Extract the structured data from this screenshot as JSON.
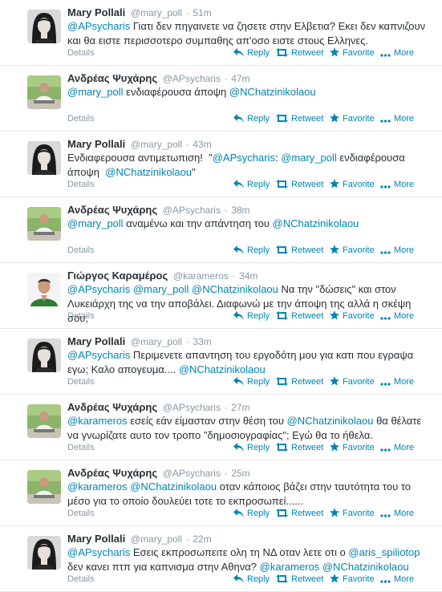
{
  "colors": {
    "link": "#0084b4",
    "meta": "#8899a6",
    "name": "#292f33"
  },
  "actions": {
    "details": "Details",
    "reply": "Reply",
    "retweet": "Retweet",
    "favorite": "Favorite",
    "more": "More"
  },
  "tweets": [
    {
      "fullname": "Mary Pollali",
      "username": "@mary_poll",
      "time": "51m",
      "avatar": "woman",
      "segments": [
        {
          "t": "@APsycharis",
          "m": true
        },
        {
          "t": " Γιατι δεν πηγαινετε να ζησετε στην Ελβετια? Εκει δεν καπνιζουν και θα ειστε περισσοτερο συμπαθης απ'οσο ειστε στους Ελληνες."
        }
      ]
    },
    {
      "fullname": "Ανδρέας Ψυχάρης",
      "username": "@APsycharis",
      "time": "47m",
      "avatar": "man-desk",
      "segments": [
        {
          "t": "@mary_poll",
          "m": true
        },
        {
          "t": " ενδιαφέρουσα άποψη "
        },
        {
          "t": "@NChatzinikolaou",
          "m": true
        }
      ]
    },
    {
      "fullname": "Mary Pollali",
      "username": "@mary_poll",
      "time": "43m",
      "avatar": "woman",
      "segments": [
        {
          "t": "Ενδιαφερουσα αντιμετωπιση!  \""
        },
        {
          "t": "@APsycharis",
          "m": true
        },
        {
          "t": ": "
        },
        {
          "t": "@mary_poll",
          "m": true
        },
        {
          "t": " ενδιαφέρουσα άποψη  "
        },
        {
          "t": "@NChatzinikolaou",
          "m": true
        },
        {
          "t": "\""
        }
      ]
    },
    {
      "fullname": "Ανδρέας Ψυχάρης",
      "username": "@APsycharis",
      "time": "38m",
      "avatar": "man-desk",
      "segments": [
        {
          "t": "@mary_poll",
          "m": true
        },
        {
          "t": " αναμένω και την απάντηση του "
        },
        {
          "t": "@NChatzinikolaou",
          "m": true
        }
      ]
    },
    {
      "fullname": "Γιώργος Καραμέρος",
      "username": "@karameros",
      "time": "34m",
      "avatar": "man-green",
      "segments": [
        {
          "t": "@APsycharis",
          "m": true
        },
        {
          "t": " "
        },
        {
          "t": "@mary_poll",
          "m": true
        },
        {
          "t": " "
        },
        {
          "t": "@NChatzinikolaou",
          "m": true
        },
        {
          "t": " Να την \"δώσεις\" και στον Λυκειάρχη της να την αποβάλει. Διαφωνώ με την άποψη της αλλά η σκέψη σου;"
        }
      ]
    },
    {
      "fullname": "Mary Pollali",
      "username": "@mary_poll",
      "time": "33m",
      "avatar": "woman",
      "segments": [
        {
          "t": "@APsycharis",
          "m": true
        },
        {
          "t": " Περιμενετε απαντηση του εργοδότη μου για κατι που εγραψα εγω; Καλο απογευμα.... "
        },
        {
          "t": "@NChatzinikolaou",
          "m": true
        }
      ]
    },
    {
      "fullname": "Ανδρέας Ψυχάρης",
      "username": "@APsycharis",
      "time": "27m",
      "avatar": "man-desk",
      "segments": [
        {
          "t": "@karameros",
          "m": true
        },
        {
          "t": " εσείς εάν είμασταν στην θέση του "
        },
        {
          "t": "@NChatzinikolaou",
          "m": true
        },
        {
          "t": " θα θέλατε να γνωρίζατε αυτο τον τροπο \"δημοσιογραφίας\"; Εγώ θα το ήθελα."
        }
      ]
    },
    {
      "fullname": "Ανδρέας Ψυχάρης",
      "username": "@APsycharis",
      "time": "25m",
      "avatar": "man-desk",
      "segments": [
        {
          "t": "@karameros",
          "m": true
        },
        {
          "t": " "
        },
        {
          "t": "@NChatzinikolaou",
          "m": true
        },
        {
          "t": " οταν κάποιος βάζει στην ταυτότητα του το μέσο για το οποίο δουλεύει τοτε το εκπροσωπεί......"
        }
      ]
    },
    {
      "fullname": "Mary Pollali",
      "username": "@mary_poll",
      "time": "22m",
      "avatar": "woman",
      "segments": [
        {
          "t": "@APsycharis",
          "m": true
        },
        {
          "t": " Εσεις εκπροσωπειτε ολη τη ΝΔ οταν λετε οτι ο "
        },
        {
          "t": "@aris_spiliotop",
          "m": true
        },
        {
          "t": " δεν κανει πτπ για καπνισμα στην Αθηνα? "
        },
        {
          "t": "@karameros",
          "m": true
        },
        {
          "t": " "
        },
        {
          "t": "@NChatzinikolaou",
          "m": true
        }
      ]
    }
  ]
}
